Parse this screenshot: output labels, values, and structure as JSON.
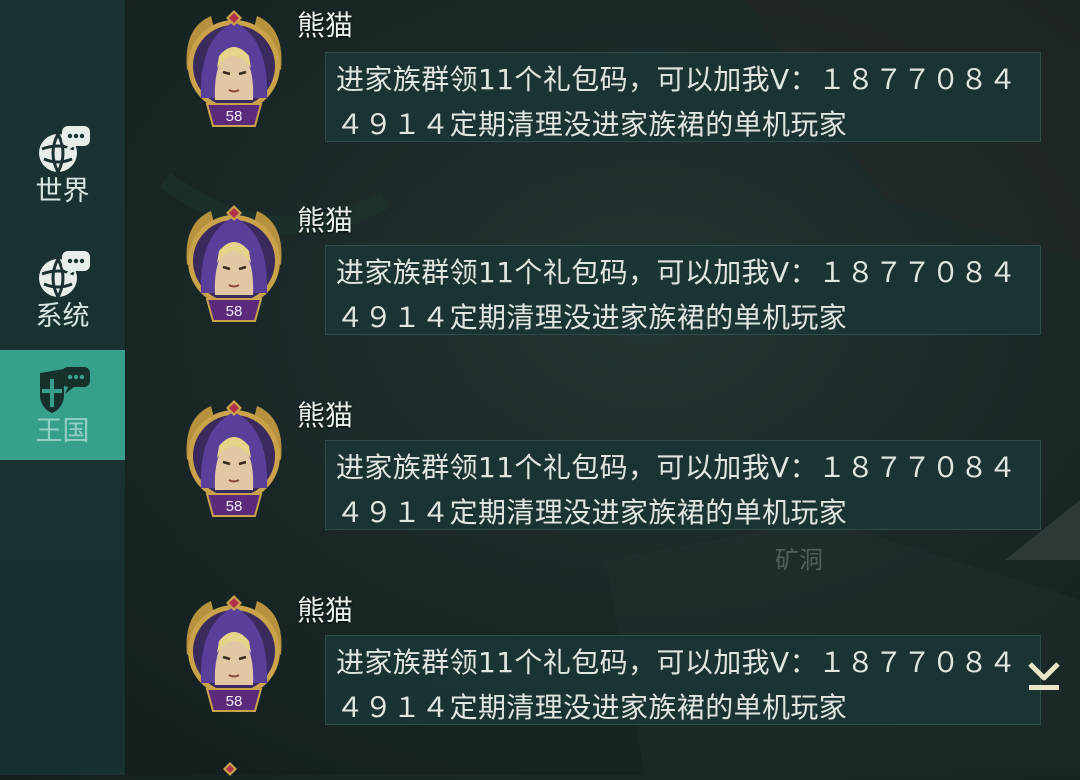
{
  "sidebar": {
    "tabs": [
      {
        "label": "世界",
        "icon": "chat-globe-icon",
        "active": false
      },
      {
        "label": "系统",
        "icon": "chat-globe-icon",
        "active": false
      },
      {
        "label": "王国",
        "icon": "kingdom-shield-icon",
        "active": true
      }
    ]
  },
  "background": {
    "map_label": "矿洞"
  },
  "messages": [
    {
      "sender": "熊猫",
      "level": "58",
      "text": "进家族群领11个礼包码，可以加我V：１８７７０８４４９１４定期清理没进家族裙的单机玩家"
    },
    {
      "sender": "熊猫",
      "level": "58",
      "text": "进家族群领11个礼包码，可以加我V：１８７７０８４４９１４定期清理没进家族裙的单机玩家"
    },
    {
      "sender": "熊猫",
      "level": "58",
      "text": "进家族群领11个礼包码，可以加我V：１８７７０８４４９１４定期清理没进家族裙的单机玩家"
    },
    {
      "sender": "熊猫",
      "level": "58",
      "text": "进家族群领11个礼包码，可以加我V：１８７７０８４４９１４定期清理没进家族裙的单机玩家"
    }
  ],
  "controls": {
    "scroll_down_icon": "scroll-to-bottom-icon"
  },
  "colors": {
    "accent_tab": "#37a08c",
    "bubble_bg": "#1b3434",
    "level_badge": "#6b2f8c",
    "frame_gold": "#c9a24a"
  }
}
